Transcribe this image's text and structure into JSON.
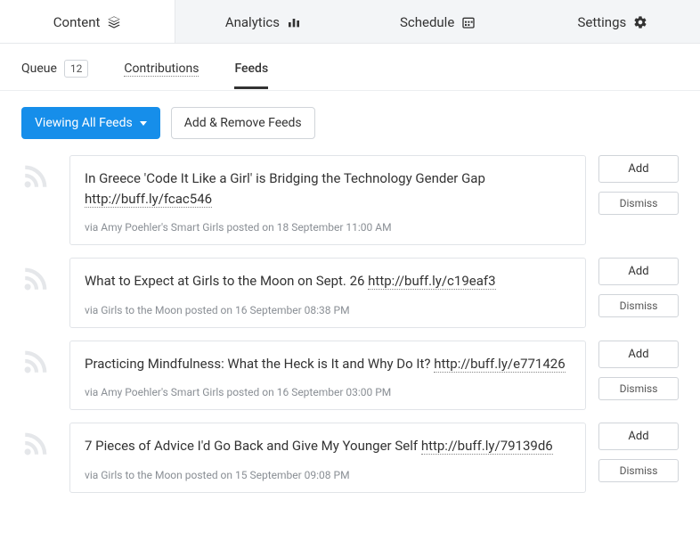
{
  "top_tabs": [
    {
      "label": "Content",
      "icon": "stack-icon"
    },
    {
      "label": "Analytics",
      "icon": "bars-icon"
    },
    {
      "label": "Schedule",
      "icon": "calendar-icon"
    },
    {
      "label": "Settings",
      "icon": "gear-icon"
    }
  ],
  "sub_tabs": {
    "queue_label": "Queue",
    "queue_count": "12",
    "contributions_label": "Contributions",
    "feeds_label": "Feeds"
  },
  "toolbar": {
    "viewing_label": "Viewing All Feeds",
    "add_remove_label": "Add & Remove Feeds"
  },
  "actions": {
    "add": "Add",
    "dismiss": "Dismiss"
  },
  "feeds": [
    {
      "title": "In Greece 'Code It Like a Girl' is Bridging the Technology Gender Gap",
      "url": "http://buff.ly/fcac546",
      "meta": "via Amy Poehler's Smart Girls posted on 18 September 11:00 AM"
    },
    {
      "title": "What to Expect at Girls to the Moon on Sept. 26",
      "url": "http://buff.ly/c19eaf3",
      "meta": "via Girls to the Moon posted on 16 September 08:38 PM"
    },
    {
      "title": "Practicing Mindfulness: What the Heck is It and Why Do It?",
      "url": "http://buff.ly/e771426",
      "meta": "via Amy Poehler's Smart Girls posted on 16 September 03:00 PM"
    },
    {
      "title": "7 Pieces of Advice I'd Go Back and Give My Younger Self",
      "url": "http://buff.ly/79139d6",
      "meta": "via Girls to the Moon posted on 15 September 09:08 PM"
    }
  ]
}
